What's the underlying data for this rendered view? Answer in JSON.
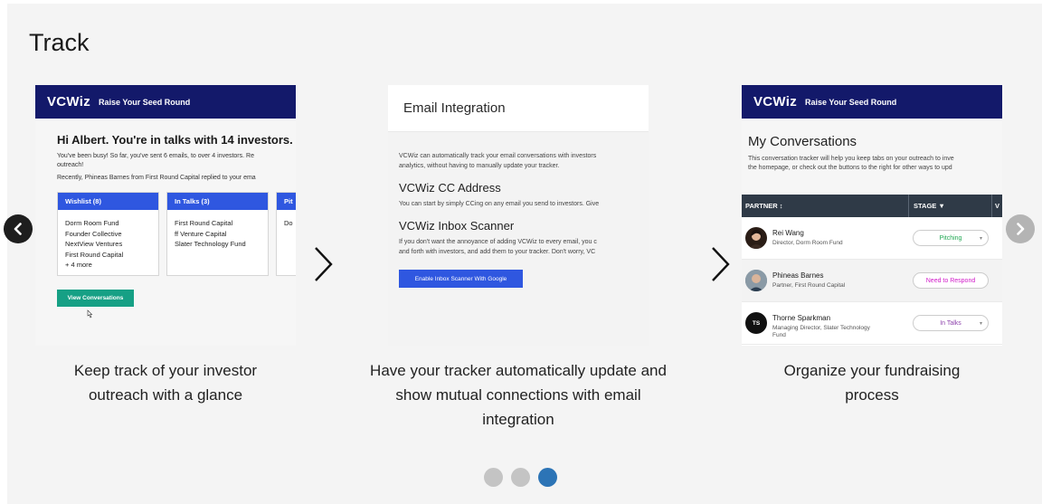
{
  "section": {
    "title": "Track"
  },
  "nav": {
    "prev_icon": "chevron-left-icon",
    "next_icon": "chevron-right-icon"
  },
  "card1": {
    "brand": "VCWiz",
    "tagline": "Raise Your Seed Round",
    "greeting": "Hi Albert. You're in talks with 14 investors.",
    "lines": [
      "You've been busy! So far, you've sent 6 emails, to over 4 investors. Re",
      "outreach!",
      "Recently, Phineas Barnes from First Round Capital replied to your ema"
    ],
    "columns": [
      {
        "title": "Wishlist (8)",
        "items": [
          "Dorm Room Fund",
          "Founder Collective",
          "NextView Ventures",
          "First Round Capital",
          "+ 4 more"
        ]
      },
      {
        "title": "In Talks (3)",
        "items": [
          "First Round Capital",
          "ff Venture Capital",
          "Slater Technology Fund"
        ]
      },
      {
        "title": "Pit",
        "items": [
          "Do"
        ]
      }
    ],
    "button": "View Conversations"
  },
  "card2": {
    "header": "Email Integration",
    "intro": [
      "VCWiz can automatically track your email conversations with investors",
      "analytics, without having to manually update your tracker."
    ],
    "cc_title": "VCWiz CC Address",
    "cc_text": "You can start by simply CCing on any email you send to investors. Give",
    "scanner_title": "VCWiz Inbox Scanner",
    "scanner_text": [
      "If you don't want the annoyance of adding VCWiz to every email, you c",
      "and forth with investors, and add them to your tracker. Don't worry, VC"
    ],
    "button": "Enable Inbox Scanner With Google"
  },
  "card3": {
    "brand": "VCWiz",
    "tagline": "Raise Your Seed Round",
    "title": "My Conversations",
    "sub": [
      "This conversation tracker will help you keep tabs on your outreach to inve",
      "the homepage, or check out the buttons to the right for other ways to upd"
    ],
    "headers": {
      "partner": "PARTNER ↕",
      "stage": "STAGE ▼",
      "more": "V"
    },
    "rows": [
      {
        "initials": "",
        "name": "Rei Wang",
        "role": [
          "Director, Dorm Room Fund"
        ],
        "stage": "Pitching",
        "caret": "▾"
      },
      {
        "initials": "",
        "name": "Phineas Barnes",
        "role": [
          "Partner, First Round Capital"
        ],
        "stage": "Need to Respond",
        "caret": ""
      },
      {
        "initials": "TS",
        "name": "Thorne Sparkman",
        "role": [
          "Managing Director, Slater Technology",
          "Fund"
        ],
        "stage": "In Talks",
        "caret": "▾"
      }
    ]
  },
  "captions": {
    "one": [
      "Keep track of your investor",
      "outreach with a glance"
    ],
    "two": [
      "Have your tracker automatically update and",
      "show mutual connections with email",
      "integration"
    ],
    "three": [
      "Organize your fundraising",
      "process"
    ]
  },
  "pagination": {
    "count": 3,
    "active": 3
  }
}
